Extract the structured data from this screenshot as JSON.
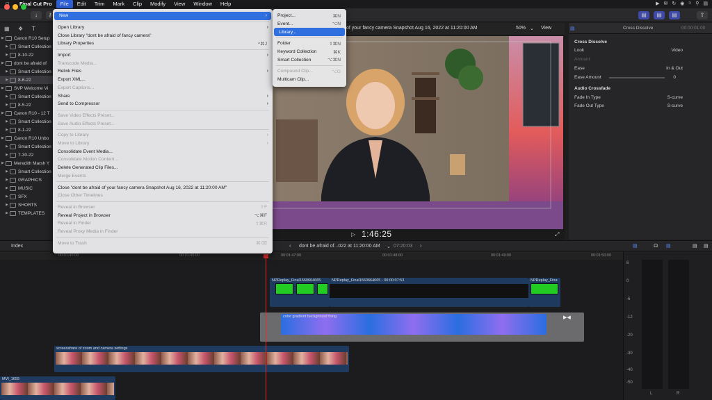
{
  "menubar": {
    "apple": "",
    "app_name": "Final Cut Pro",
    "items": [
      "File",
      "Edit",
      "Trim",
      "Mark",
      "Clip",
      "Modify",
      "View",
      "Window",
      "Help"
    ]
  },
  "browser": {
    "rows": [
      {
        "label": "Canon R10 Setup",
        "level": 0,
        "kind": "library"
      },
      {
        "label": "Smart Collection",
        "level": 1,
        "kind": "folder"
      },
      {
        "label": "8-10-22",
        "level": 1,
        "kind": "event"
      },
      {
        "label": "dont be afraid of",
        "level": 0,
        "kind": "library"
      },
      {
        "label": "Smart Collection",
        "level": 1,
        "kind": "folder"
      },
      {
        "label": "8-6-22",
        "level": 1,
        "kind": "event",
        "selected": true
      },
      {
        "label": "SVP Welcome Vi",
        "level": 0,
        "kind": "library"
      },
      {
        "label": "Smart Collection",
        "level": 1,
        "kind": "folder"
      },
      {
        "label": "8-5-22",
        "level": 1,
        "kind": "event"
      },
      {
        "label": "Canon R10 - 12 T",
        "level": 0,
        "kind": "library"
      },
      {
        "label": "Smart Collection",
        "level": 1,
        "kind": "folder"
      },
      {
        "label": "8-1-22",
        "level": 1,
        "kind": "event"
      },
      {
        "label": "Canon R10 Unbo",
        "level": 0,
        "kind": "library"
      },
      {
        "label": "Smart Collection",
        "level": 1,
        "kind": "folder"
      },
      {
        "label": "7-30-22",
        "level": 1,
        "kind": "event"
      },
      {
        "label": "Meredith Marsh Y",
        "level": 0,
        "kind": "library"
      },
      {
        "label": "Smart Collection",
        "level": 1,
        "kind": "folder"
      },
      {
        "label": "GRAPHICS",
        "level": 1,
        "kind": "event"
      },
      {
        "label": "MUSIC",
        "level": 1,
        "kind": "event"
      },
      {
        "label": "SFX",
        "level": 1,
        "kind": "event"
      },
      {
        "label": "SHORTS",
        "level": 1,
        "kind": "event"
      },
      {
        "label": "TEMPLATES",
        "level": 1,
        "kind": "event"
      }
    ]
  },
  "file_menu": {
    "items": [
      {
        "label": "New",
        "shortcut": "",
        "sub": true,
        "hl": true,
        "dis": false
      },
      {
        "sep": true
      },
      {
        "label": "Open Library",
        "shortcut": "",
        "sub": true,
        "dis": false
      },
      {
        "label": "Close Library \"dont be afraid of fancy camera\"",
        "shortcut": "",
        "dis": false
      },
      {
        "label": "Library Properties",
        "shortcut": "^⌘J",
        "dis": false
      },
      {
        "sep": true
      },
      {
        "label": "Import",
        "shortcut": "",
        "sub": true,
        "dis": false
      },
      {
        "label": "Transcode Media...",
        "shortcut": "",
        "dis": true
      },
      {
        "label": "Relink Files",
        "shortcut": "",
        "sub": true,
        "dis": false
      },
      {
        "label": "Export XML...",
        "shortcut": "",
        "dis": false
      },
      {
        "label": "Export Captions...",
        "shortcut": "",
        "dis": true
      },
      {
        "label": "Share",
        "shortcut": "",
        "sub": true,
        "dis": false
      },
      {
        "label": "Send to Compressor",
        "shortcut": "",
        "sub": true,
        "dis": false
      },
      {
        "sep": true
      },
      {
        "label": "Save Video Effects Preset...",
        "shortcut": "",
        "dis": true
      },
      {
        "label": "Save Audio Effects Preset...",
        "shortcut": "",
        "dis": true
      },
      {
        "sep": true
      },
      {
        "label": "Copy to Library",
        "shortcut": "",
        "sub": true,
        "dis": true
      },
      {
        "label": "Move to Library",
        "shortcut": "",
        "sub": true,
        "dis": true
      },
      {
        "label": "Consolidate Event Media...",
        "shortcut": "",
        "dis": false
      },
      {
        "label": "Consolidate Motion Content...",
        "shortcut": "",
        "dis": true
      },
      {
        "label": "Delete Generated Clip Files...",
        "shortcut": "",
        "dis": false
      },
      {
        "label": "Merge Events",
        "shortcut": "",
        "dis": true
      },
      {
        "sep": true
      },
      {
        "label": "Close \"dont be afraid of your fancy camera Snapshot Aug 16, 2022 at 11:20:00 AM\"",
        "shortcut": "",
        "dis": false
      },
      {
        "label": "Close Other Timelines",
        "shortcut": "",
        "dis": true
      },
      {
        "sep": true
      },
      {
        "label": "Reveal in Browser",
        "shortcut": "⇧F",
        "dis": true
      },
      {
        "label": "Reveal Project in Browser",
        "shortcut": "⌥⌘F",
        "dis": false
      },
      {
        "label": "Reveal in Finder",
        "shortcut": "⇧⌘R",
        "dis": true
      },
      {
        "label": "Reveal Proxy Media in Finder",
        "shortcut": "",
        "dis": true
      },
      {
        "sep": true
      },
      {
        "label": "Move to Trash",
        "shortcut": "⌘⌫",
        "dis": true
      }
    ]
  },
  "new_menu": {
    "items": [
      {
        "label": "Project...",
        "shortcut": "⌘N",
        "dis": false
      },
      {
        "label": "Event...",
        "shortcut": "⌥N",
        "dis": false
      },
      {
        "label": "Library...",
        "shortcut": "",
        "dis": false,
        "hl": true
      },
      {
        "sep": true
      },
      {
        "label": "Folder",
        "shortcut": "⇧⌘N",
        "dis": false
      },
      {
        "label": "Keyword Collection",
        "shortcut": "⌘K",
        "dis": false
      },
      {
        "label": "Smart Collection",
        "shortcut": "⌥⌘N",
        "dis": false
      },
      {
        "sep": true
      },
      {
        "label": "Compound Clip...",
        "shortcut": "⌥G",
        "dis": true
      },
      {
        "label": "Multicam Clip...",
        "shortcut": "",
        "dis": false
      }
    ]
  },
  "viewer": {
    "title": "of your fancy camera Snapshot Aug 16, 2022 at 11:20:00 AM",
    "zoom": "50%",
    "view_label": "View",
    "timecode": "1:46:25"
  },
  "inspector": {
    "title": "Cross Dissolve",
    "duration": "00:00:01:00",
    "section1": "Cross Dissolve",
    "look_label": "Look",
    "look_value": "Video",
    "amount_label": "Amount",
    "ease_label": "Ease",
    "ease_value": "In & Out",
    "ease_amount_label": "Ease Amount",
    "ease_amount_value": "0",
    "section2": "Audio Crossfade",
    "fade_in_label": "Fade In Type",
    "fade_in_value": "S-curve",
    "fade_out_label": "Fade Out Type",
    "fade_out_value": "S-curve"
  },
  "timeline_bar": {
    "index_label": "Index",
    "project_name": "dont be afraid of...022 at 11:20:00 AM",
    "duration": "07:20:03"
  },
  "ruler_ticks": [
    "00:01:40:00",
    "00:01:45:00",
    "00:01:47:00",
    "00:01:48:00",
    "00:01:49:00",
    "00:01:50:00"
  ],
  "clips": {
    "zoom_clip_a": "NPReplay_Final1660664665",
    "zoom_clip_b": "NPReplay_Final1660664665 - 00:00:07:53",
    "zoom_clip_c": "NPReplay_Fina",
    "gradient": "color gradient background thing",
    "screenshare": "screenshare of zoom and camera settings",
    "mvi": "MVI_1655"
  },
  "meter_scale": [
    "6",
    "0",
    "-6",
    "-12",
    "-20",
    "-30",
    "-40",
    "-50"
  ],
  "meter_channels": [
    "L",
    "R"
  ],
  "colors": {
    "accent": "#2f6fe0",
    "gradient_clip": "#3a6fe0",
    "green_clip": "#22cc22"
  }
}
